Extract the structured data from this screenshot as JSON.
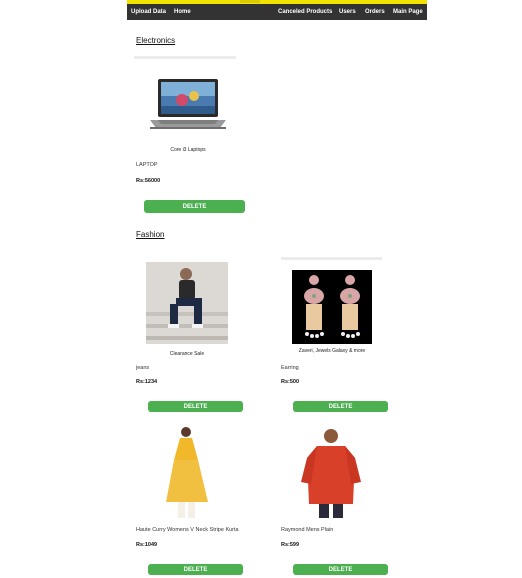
{
  "nav": {
    "left": [
      "Upload Data",
      "Home"
    ],
    "right": [
      "Canceled Products",
      "Users",
      "Orders",
      "Main Page"
    ]
  },
  "sections": [
    {
      "title": "Electronics",
      "products": [
        {
          "caption": "Core i3 Laptops",
          "name": "LAPTOP",
          "price": "Rs:56000",
          "button": "DELETE"
        }
      ]
    },
    {
      "title": "Fashion",
      "products": [
        {
          "caption": "Clearance Sale",
          "name": "jeans",
          "price": "Rs:1234",
          "button": "DELETE"
        },
        {
          "caption": "Zaveri, Jewels Galaxy & more",
          "name": "Earring",
          "price": "Rs:500",
          "button": "DELETE"
        },
        {
          "caption": "",
          "name": "Haute Curry Womens V Neck Stripe Kurta",
          "price": "Rs:1049",
          "button": "DELETE"
        },
        {
          "caption": "",
          "name": "Raymond Mens Plain",
          "price": "Rs:599",
          "button": "DELETE"
        }
      ]
    }
  ],
  "colors": {
    "navbar": "#333333",
    "accent_strip": "#f2e400",
    "button": "#4caf50"
  }
}
